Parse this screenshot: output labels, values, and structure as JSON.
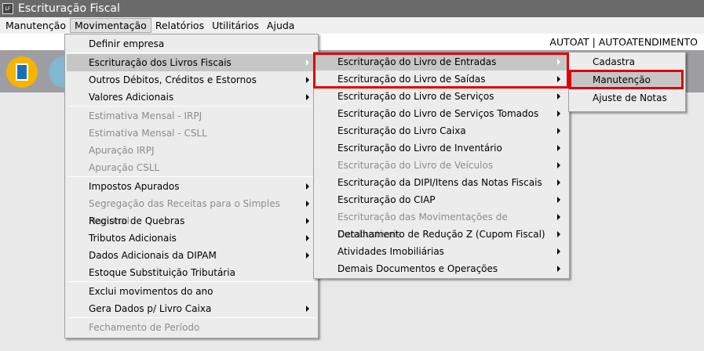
{
  "window": {
    "title": "Escrituração Fiscal",
    "logo": "LF"
  },
  "menubar": [
    "Manutenção",
    "Movimentação",
    "Relatórios",
    "Utilitários",
    "Ajuda"
  ],
  "user": "AUTOAT | AUTOATENDIMENTO",
  "toolbar_icons": [
    "building-icon",
    "contribuinte-icon"
  ],
  "menu1": [
    {
      "label": "Definir empresa"
    },
    {
      "sep": true
    },
    {
      "label": "Escrituração dos Livros Fiscais",
      "sub": true,
      "hl": true
    },
    {
      "label": "Outros Débitos, Créditos e Estornos",
      "sub": true
    },
    {
      "label": "Valores Adicionais",
      "sub": true
    },
    {
      "sep": true
    },
    {
      "label": "Estimativa Mensal - IRPJ",
      "dis": true
    },
    {
      "label": "Estimativa Mensal - CSLL",
      "dis": true
    },
    {
      "label": "Apuração IRPJ",
      "dis": true
    },
    {
      "label": "Apuração CSLL",
      "dis": true
    },
    {
      "sep": true
    },
    {
      "label": "Impostos Apurados",
      "sub": true
    },
    {
      "label": "Segregação das Receitas para o Simples Nacional",
      "sub": true,
      "dis": true
    },
    {
      "label": "Registro de Quebras",
      "sub": true
    },
    {
      "label": "Tributos Adicionais",
      "sub": true
    },
    {
      "label": "Dados Adicionais da DIPAM",
      "sub": true
    },
    {
      "label": "Estoque Substituição Tributária"
    },
    {
      "sep": true
    },
    {
      "label": "Exclui movimentos do ano"
    },
    {
      "label": "Gera Dados p/ Livro Caixa",
      "sub": true
    },
    {
      "sep": true
    },
    {
      "label": "Fechamento de Período",
      "dis": true
    }
  ],
  "menu2": [
    {
      "label": "Escrituração do Livro de Entradas",
      "sub": true,
      "hl": true
    },
    {
      "label": "Escrituração do Livro de Saídas",
      "sub": true
    },
    {
      "label": "Escrituração do Livro de Serviços",
      "sub": true
    },
    {
      "label": "Escrituração do Livro de Serviços Tomados",
      "sub": true
    },
    {
      "label": "Escrituração do Livro Caixa",
      "sub": true
    },
    {
      "label": "Escrituração do Livro de Inventário",
      "sub": true
    },
    {
      "label": "Escrituração do Livro de Veículos",
      "sub": true,
      "dis": true
    },
    {
      "label": "Escrituração da DIPI/Itens das Notas Fiscais",
      "sub": true
    },
    {
      "label": "Escrituração do CIAP",
      "sub": true
    },
    {
      "label": "Escrituração das Movimentações de Combustíveis",
      "sub": true,
      "dis": true
    },
    {
      "label": "Detalhamento de Redução Z (Cupom Fiscal)",
      "sub": true
    },
    {
      "label": "Atividades Imobiliárias",
      "sub": true
    },
    {
      "label": "Demais Documentos e Operações",
      "sub": true
    }
  ],
  "menu3": [
    {
      "label": "Cadastra"
    },
    {
      "label": "Manutenção",
      "hl": true
    },
    {
      "label": "Ajuste de Notas"
    }
  ],
  "colors": {
    "highlight_box": "#e00000",
    "titlebar": "#6a6a6a"
  }
}
